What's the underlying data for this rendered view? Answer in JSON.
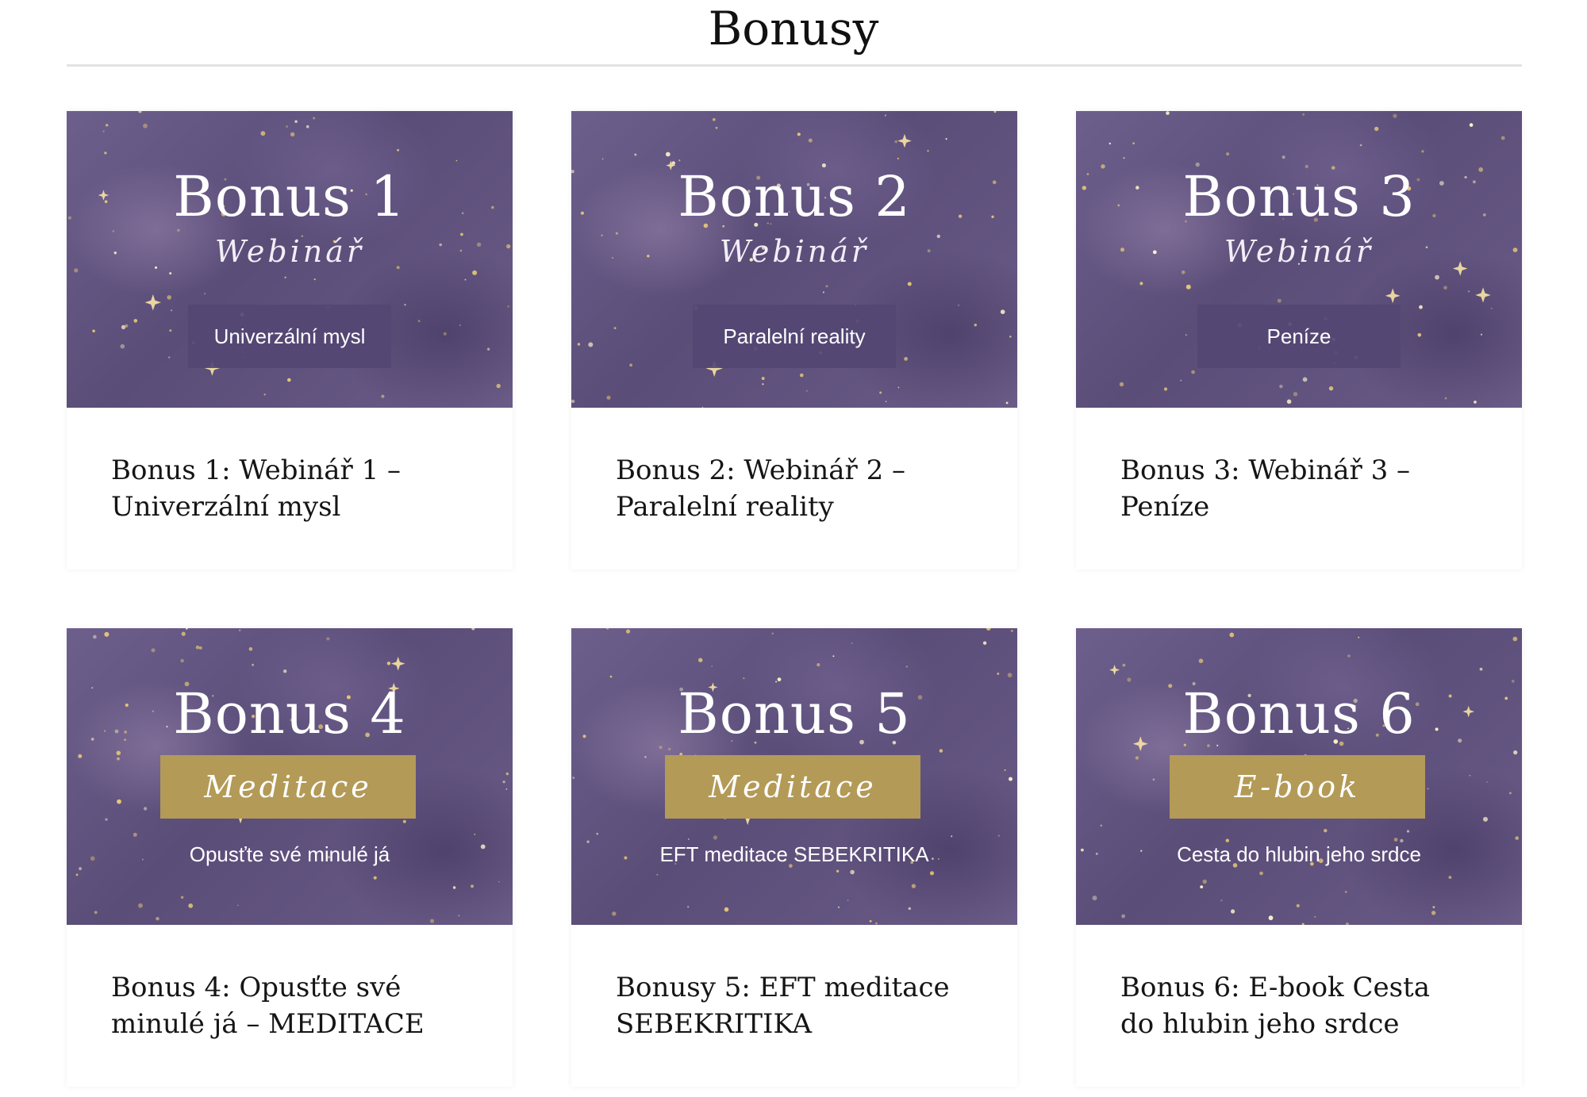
{
  "page": {
    "title": "Bonusy"
  },
  "colors": {
    "banner_purple": "#6d5f8c",
    "pill_purple": "#544673",
    "gold_box": "#b39a57",
    "title_text": "#111111",
    "divider": "#e3e3e3"
  },
  "cards": [
    {
      "banner_title": "Bonus 1",
      "banner_script": "Webinář",
      "banner_label": "Univerzální mysl",
      "style": "purple-pill",
      "text_line1": "Bonus 1: Webinář 1  –",
      "text_line2": "Univerzální mysl"
    },
    {
      "banner_title": "Bonus 2",
      "banner_script": "Webinář",
      "banner_label": "Paralelní reality",
      "style": "purple-pill",
      "text_line1": "Bonus 2: Webinář 2  –",
      "text_line2": "Paralelní reality"
    },
    {
      "banner_title": "Bonus 3",
      "banner_script": "Webinář",
      "banner_label": "Peníze",
      "style": "purple-pill",
      "text_line1": "Bonus 3: Webinář 3 –",
      "text_line2": "Peníze"
    },
    {
      "banner_title": "Bonus 4",
      "banner_script": "Meditace",
      "banner_label": "Opusťte své minulé já",
      "style": "gold-box",
      "text_line1": "Bonus 4: Opusťte své",
      "text_line2": "minulé já – MEDITACE"
    },
    {
      "banner_title": "Bonus 5",
      "banner_script": "Meditace",
      "banner_label": "EFT meditace SEBEKRITIKA",
      "style": "gold-box",
      "text_line1": "Bonusy 5: EFT meditace",
      "text_line2": "SEBEKRITIKA"
    },
    {
      "banner_title": "Bonus 6",
      "banner_script": "E-book",
      "banner_label": "Cesta do hlubin jeho srdce",
      "style": "gold-box",
      "text_line1": "Bonus 6: E-book Cesta",
      "text_line2": "do hlubin jeho srdce"
    }
  ]
}
